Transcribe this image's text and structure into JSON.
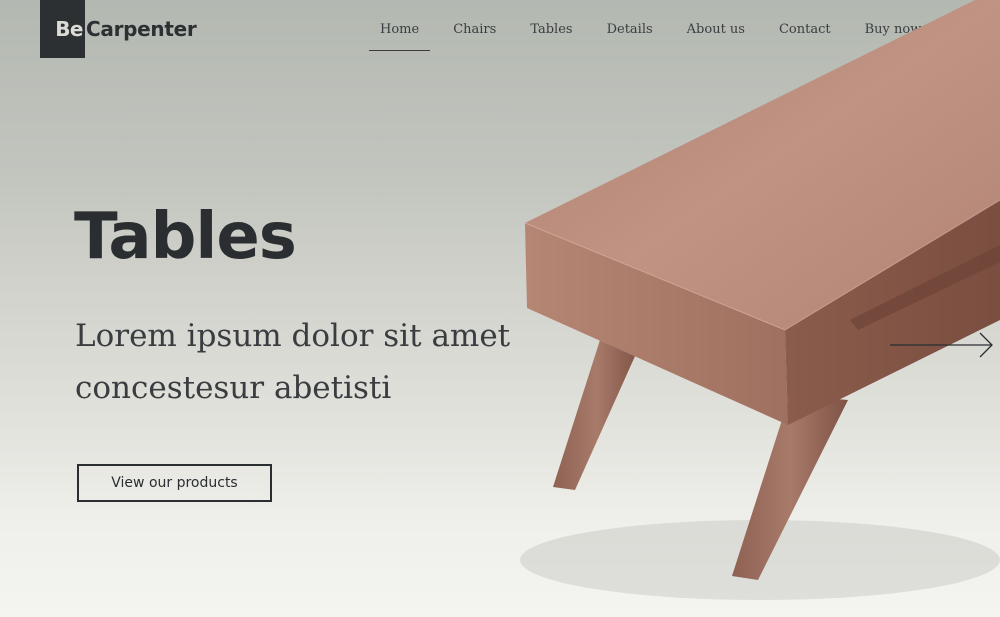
{
  "logo": {
    "prefix": "Be",
    "name": "Carpenter"
  },
  "nav": {
    "items": [
      {
        "label": "Home",
        "active": true
      },
      {
        "label": "Chairs"
      },
      {
        "label": "Tables"
      },
      {
        "label": "Details"
      },
      {
        "label": "About us"
      },
      {
        "label": "Contact"
      },
      {
        "label": "Buy now"
      }
    ]
  },
  "hero": {
    "title": "Tables",
    "subtitle": "Lorem ipsum dolor sit amet concestesur abetisti",
    "cta_label": "View our products"
  },
  "colors": {
    "text_dark": "#2a2e31",
    "logo_block": "#2d3033",
    "wood": "#b98a78"
  },
  "icons": {
    "slider_next": "arrow-right-icon"
  }
}
